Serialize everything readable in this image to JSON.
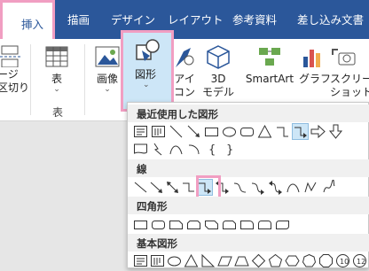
{
  "tabs": {
    "insert": "挿入",
    "draw": "描画",
    "design": "デザイン",
    "layout": "レイアウト",
    "references": "参考資料",
    "mailings": "差し込み文書"
  },
  "ribbon": {
    "page_break": "ージ\n区切り",
    "table": "表",
    "table_group": "表",
    "image": "画像",
    "shapes": "図形",
    "icons": "アイ\nコン",
    "models3d": "3D\nモデル",
    "smartart": "SmartArt",
    "graph": "グラフ",
    "screenshot": "スクリーン\nショット"
  },
  "shapes_menu": {
    "recent": "最近使用した図形",
    "lines": "線",
    "rectangles": "四角形",
    "basic": "基本図形"
  },
  "accent_color": "#2b579a",
  "highlight_color": "#f19ec2"
}
